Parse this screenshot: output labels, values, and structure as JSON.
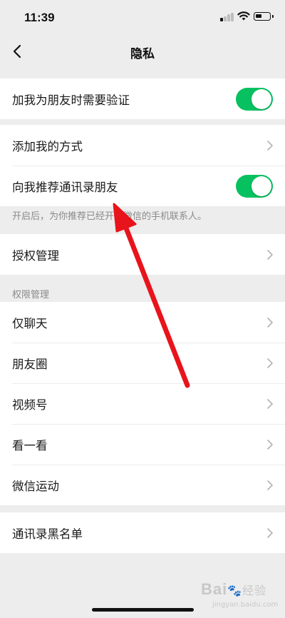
{
  "status_bar": {
    "time": "11:39",
    "icons": [
      "cellular-signal-icon",
      "wifi-icon",
      "battery-icon"
    ]
  },
  "nav": {
    "title": "隐私",
    "back_icon": "chevron-left-icon"
  },
  "groups": {
    "verify": {
      "label": "加我为朋友时需要验证",
      "toggle_on": true
    },
    "add_method": {
      "label": "添加我的方式"
    },
    "recommend": {
      "label": "向我推荐通讯录朋友",
      "toggle_on": true
    },
    "recommend_note": "开启后，为你推荐已经开通微信的手机联系人。",
    "authorization": {
      "label": "授权管理"
    },
    "permissions_header": "权限管理",
    "permissions": {
      "chat_only": "仅聊天",
      "moments": "朋友圈",
      "channels": "视频号",
      "top_stories": "看一看",
      "werun": "微信运动"
    },
    "blacklist": {
      "label": "通讯录黑名单"
    }
  },
  "watermark": {
    "brand": "Bai",
    "paw": "🐾",
    "suffix": "经验",
    "url": "jingyan.baidu.com"
  },
  "colors": {
    "toggle_on": "#07c160",
    "background": "#ededed",
    "annotation_arrow": "#e8141b"
  }
}
